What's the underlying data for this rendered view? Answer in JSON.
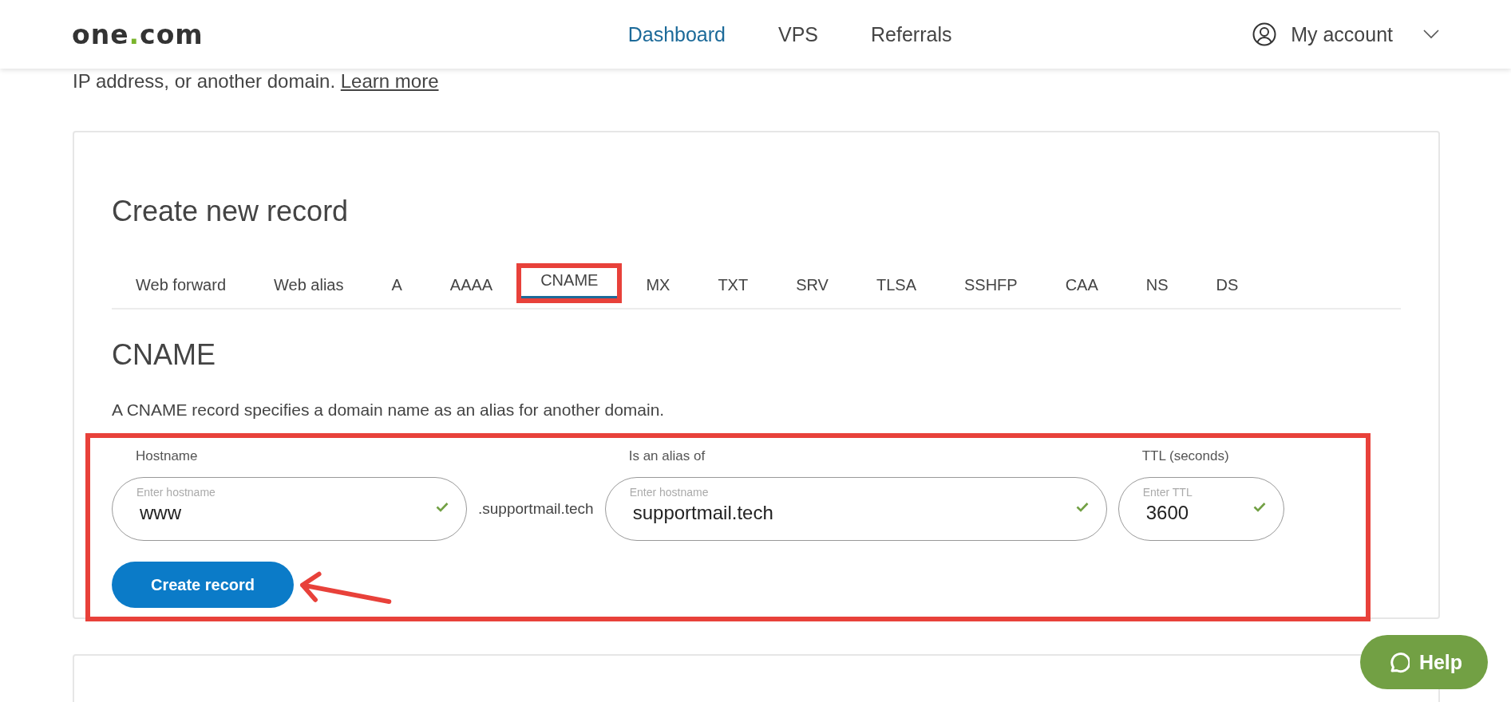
{
  "header": {
    "logo": {
      "name": "one",
      "dot": ".",
      "tld": "com"
    },
    "nav": [
      {
        "label": "Dashboard",
        "selected": true
      },
      {
        "label": "VPS",
        "selected": false
      },
      {
        "label": "Referrals",
        "selected": false
      }
    ],
    "account": "My account"
  },
  "intro": {
    "text": "IP address, or another domain.",
    "link": "Learn more"
  },
  "card": {
    "title": "Create new record",
    "tabs": [
      {
        "label": "Web forward",
        "selected": false,
        "highlighted": false
      },
      {
        "label": "Web alias",
        "selected": false,
        "highlighted": false
      },
      {
        "label": "A",
        "selected": false,
        "highlighted": false
      },
      {
        "label": "AAAA",
        "selected": false,
        "highlighted": false
      },
      {
        "label": "CNAME",
        "selected": true,
        "highlighted": true
      },
      {
        "label": "MX",
        "selected": false,
        "highlighted": false
      },
      {
        "label": "TXT",
        "selected": false,
        "highlighted": false
      },
      {
        "label": "SRV",
        "selected": false,
        "highlighted": false
      },
      {
        "label": "TLSA",
        "selected": false,
        "highlighted": false
      },
      {
        "label": "SSHFP",
        "selected": false,
        "highlighted": false
      },
      {
        "label": "CAA",
        "selected": false,
        "highlighted": false
      },
      {
        "label": "NS",
        "selected": false,
        "highlighted": false
      },
      {
        "label": "DS",
        "selected": false,
        "highlighted": false
      }
    ],
    "section_title": "CNAME",
    "description": "A CNAME record specifies a domain name as an alias for another domain.",
    "form": {
      "highlighted": true,
      "arrow": true,
      "fields": [
        {
          "label": "Hostname",
          "floating_label": "Enter hostname",
          "value": "www",
          "valid": true,
          "suffix": ".supportmail.tech"
        },
        {
          "label": "Is an alias of",
          "floating_label": "Enter hostname",
          "value": "supportmail.tech",
          "valid": true
        },
        {
          "label": "TTL (seconds)",
          "floating_label": "Enter TTL",
          "value": "3600",
          "valid": true
        }
      ],
      "button": "Create record"
    }
  },
  "help": "Help"
}
